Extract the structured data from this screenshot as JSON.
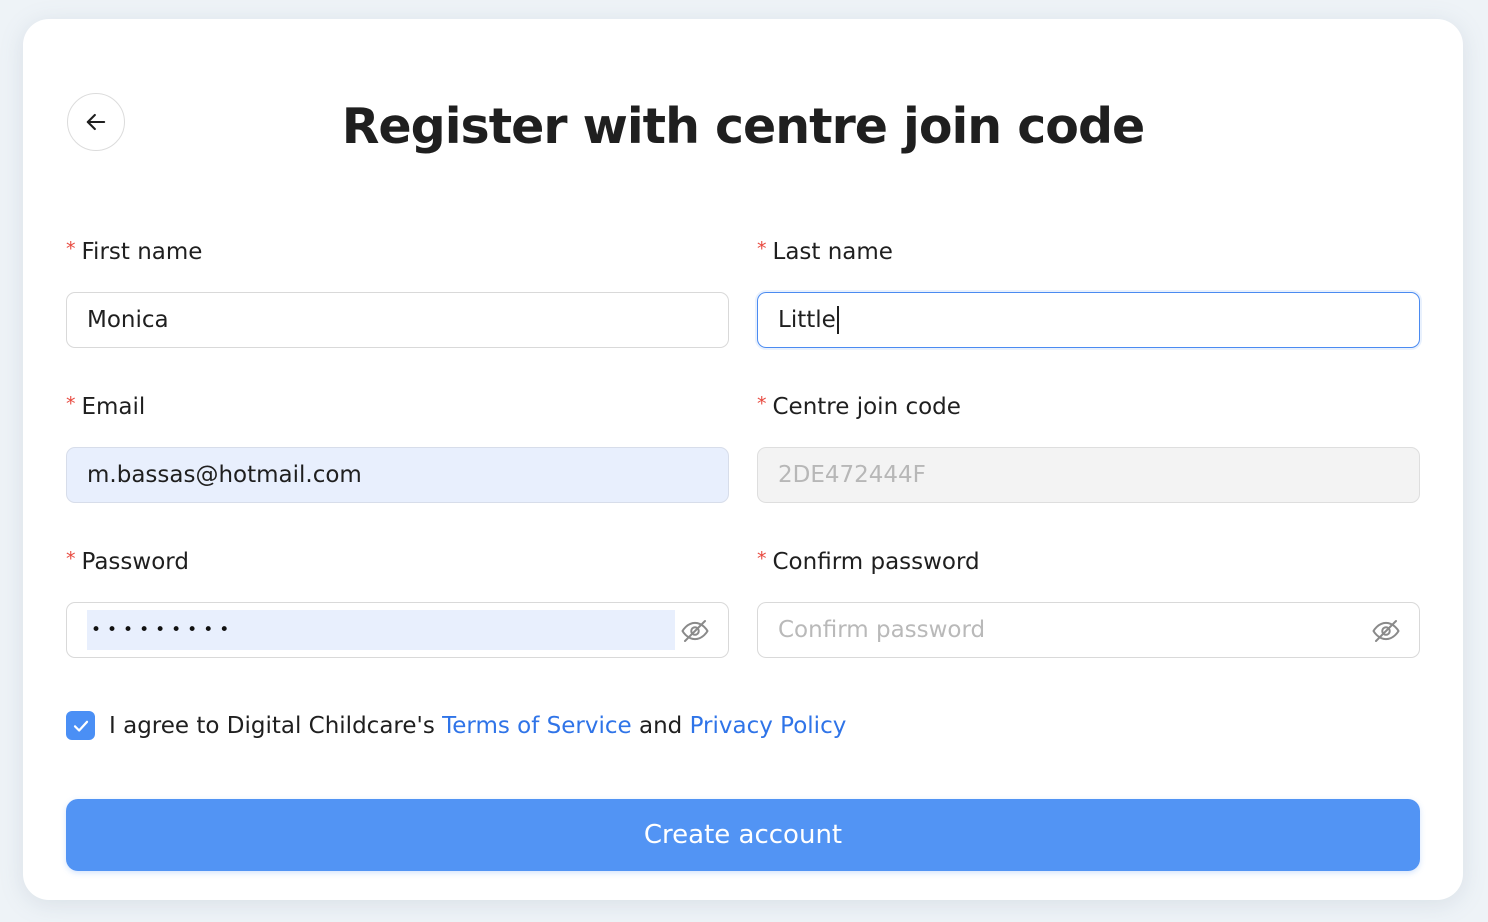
{
  "page": {
    "title": "Register with centre join code"
  },
  "form": {
    "first_name": {
      "label": "First name",
      "value": "Monica"
    },
    "last_name": {
      "label": "Last name",
      "value": "Little"
    },
    "email": {
      "label": "Email",
      "value": "m.bassas@hotmail.com"
    },
    "join_code": {
      "label": "Centre join code",
      "value": "2DE472444F"
    },
    "password": {
      "label": "Password",
      "masked_value": "•••••••••"
    },
    "confirm_password": {
      "label": "Confirm password",
      "placeholder": "Confirm password"
    },
    "required_marker": "*"
  },
  "agreement": {
    "checked": true,
    "prefix": "I agree to Digital Childcare's",
    "terms_link": "Terms of Service",
    "conjunction": "and",
    "privacy_link": "Privacy Policy"
  },
  "actions": {
    "submit_label": "Create account"
  },
  "icons": {
    "back": "arrow-left-icon",
    "eye": "eye-off-icon",
    "check": "checkmark-icon"
  },
  "colors": {
    "accent": "#5294f4",
    "link": "#2f74e8",
    "required": "#e8493f",
    "autofill_bg": "#e8effd",
    "focus_border": "#4b8bf1"
  }
}
